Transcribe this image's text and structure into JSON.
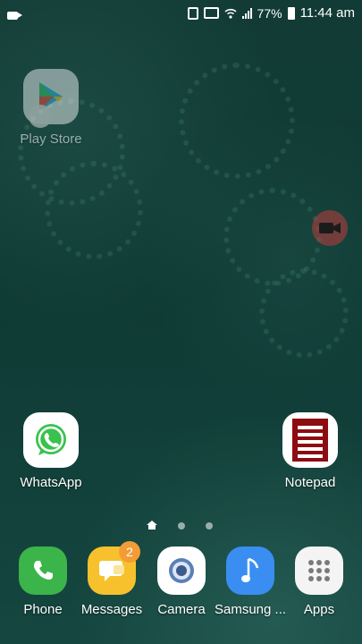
{
  "status_bar": {
    "battery": "77%",
    "time": "11:44 am"
  },
  "home": {
    "apps": [
      {
        "label": "Play Store",
        "icon": "play-store-icon"
      },
      {
        "label": "WhatsApp",
        "icon": "whatsapp-icon"
      },
      {
        "label": "Notepad",
        "icon": "notepad-icon"
      }
    ],
    "page_indicator": {
      "pages": 3,
      "current": 1
    }
  },
  "dock": {
    "apps": [
      {
        "label": "Phone",
        "icon": "phone-icon"
      },
      {
        "label": "Messages",
        "icon": "messages-icon",
        "badge": "2"
      },
      {
        "label": "Camera",
        "icon": "camera-icon"
      },
      {
        "label": "Samsung ...",
        "icon": "music-note-icon"
      },
      {
        "label": "Apps",
        "icon": "apps-grid-icon"
      }
    ]
  },
  "colors": {
    "phone": "#3bb44a",
    "messages": "#f6c12c",
    "camera": "#ffffff",
    "samsung_music": "#3a8ef2",
    "apps": "#f4f4f4",
    "whatsapp": "#ffffff",
    "notepad_bg": "#ffffff",
    "notepad_paper": "#8d0c11",
    "badge": "#f39c35",
    "record_button": "#be3c3c"
  }
}
